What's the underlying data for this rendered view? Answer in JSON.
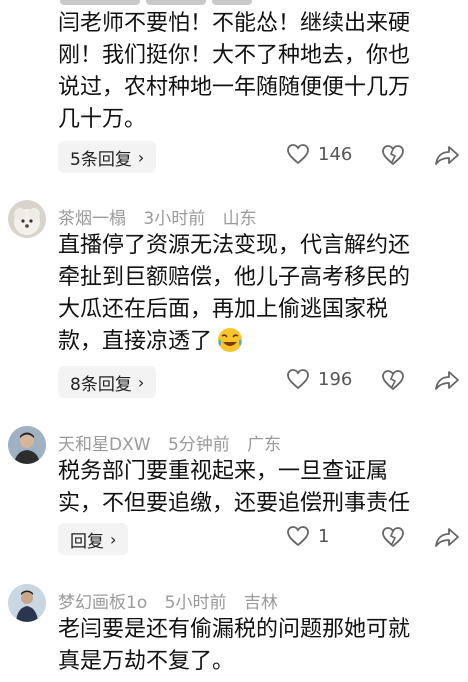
{
  "comments": [
    {
      "body_lines": [
        "闫老师不要怕！不能怂！继续出来硬",
        "刚！我们挺你！大不了种地去，你也",
        "说过，农村种地一年随随便便十几万",
        "几十万。"
      ],
      "replies_label": "5条回复",
      "likes": "146"
    },
    {
      "name": "茶烟一榻",
      "time": "3小时前",
      "location": "山东",
      "body_lines": [
        "直播停了资源无法变现，代言解约还",
        "牵扯到巨额赔偿，他儿子高考移民的",
        "大瓜还在后面，再加上偷逃国家税",
        "款，直接凉透了"
      ],
      "emoji": "laughing-crying-emoji",
      "replies_label": "8条回复",
      "likes": "196"
    },
    {
      "name": "天和星DXW",
      "time": "5分钟前",
      "location": "广东",
      "body_lines": [
        "税务部门要重视起来，一旦查证属",
        "实，不但要追缴，还要追偿刑事责任"
      ],
      "replies_label": "回复",
      "likes": "1"
    },
    {
      "name": "梦幻画板1o",
      "time": "5小时前",
      "location": "吉林",
      "body_lines": [
        "老闫要是还有偷漏税的问题那她可就",
        "真是万劫不复了。"
      ]
    }
  ],
  "icons": {
    "like": "heart-outline-icon",
    "dislike": "broken-heart-icon",
    "share": "share-arrow-icon",
    "chevron": "chevron-right-icon"
  },
  "colors": {
    "meta": "#9a9a9a",
    "text": "#111111",
    "pill_bg": "#f3f3f3",
    "icon": "#666666"
  }
}
